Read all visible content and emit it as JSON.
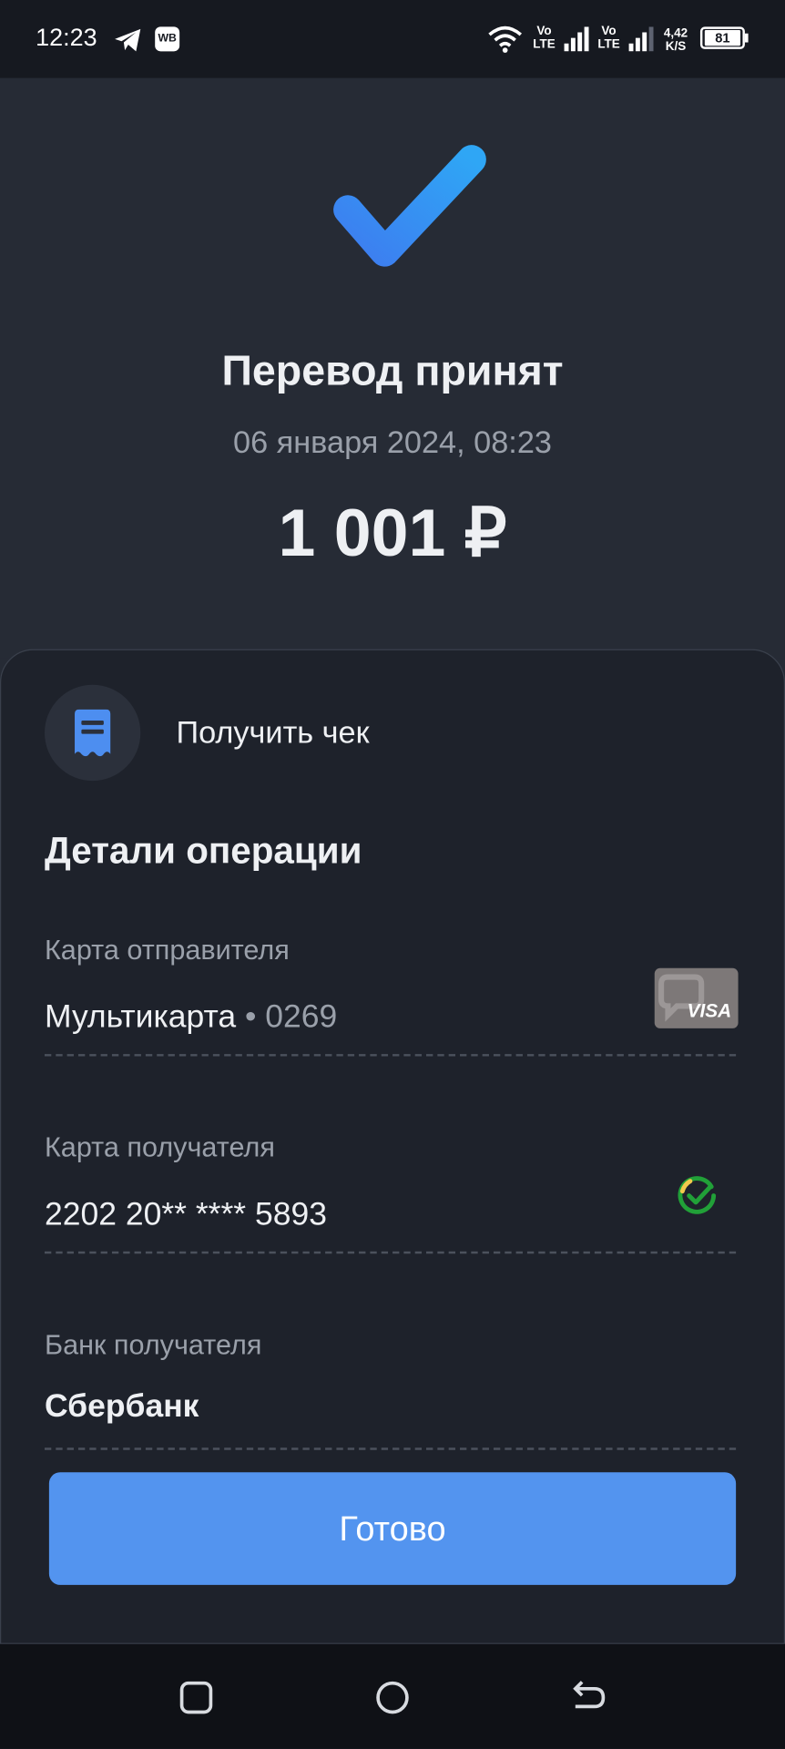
{
  "status_bar": {
    "time": "12:23",
    "app_badge": "WB",
    "network_label_1": "Vo",
    "network_label_1b": "LTE",
    "network_label_2": "Vo",
    "network_label_2b": "LTE",
    "speed_value": "4,42",
    "speed_unit": "K/S",
    "battery": "81",
    "icons": [
      "telegram-icon",
      "wb-icon",
      "wifi-icon",
      "signal-icon",
      "signal-icon",
      "battery-icon"
    ]
  },
  "result": {
    "icon": "check-icon",
    "title": "Перевод принят",
    "datetime": "06 января 2024, 08:23",
    "amount": "1 001 ₽"
  },
  "receipt": {
    "icon": "receipt-icon",
    "label": "Получить чек"
  },
  "details": {
    "title": "Детали операции",
    "sender": {
      "label": "Карта отправителя",
      "card_name": "Мультикарта",
      "card_number": "• 0269",
      "card_brand": "VISA"
    },
    "recipient": {
      "label": "Карта получателя",
      "value": "2202 20** **** 5893",
      "bank_icon": "sber-icon"
    },
    "bank": {
      "label": "Банк получателя",
      "value": "Сбербанк"
    }
  },
  "actions": {
    "done_label": "Готово"
  },
  "navigation": {
    "items": [
      "recents-icon",
      "home-icon",
      "back-icon"
    ]
  },
  "colors": {
    "accent": "#5394ef",
    "background_top": "#262b35",
    "sheet": "#1e222b",
    "text_primary": "#eef0f3",
    "text_secondary": "#9aa0aa"
  }
}
